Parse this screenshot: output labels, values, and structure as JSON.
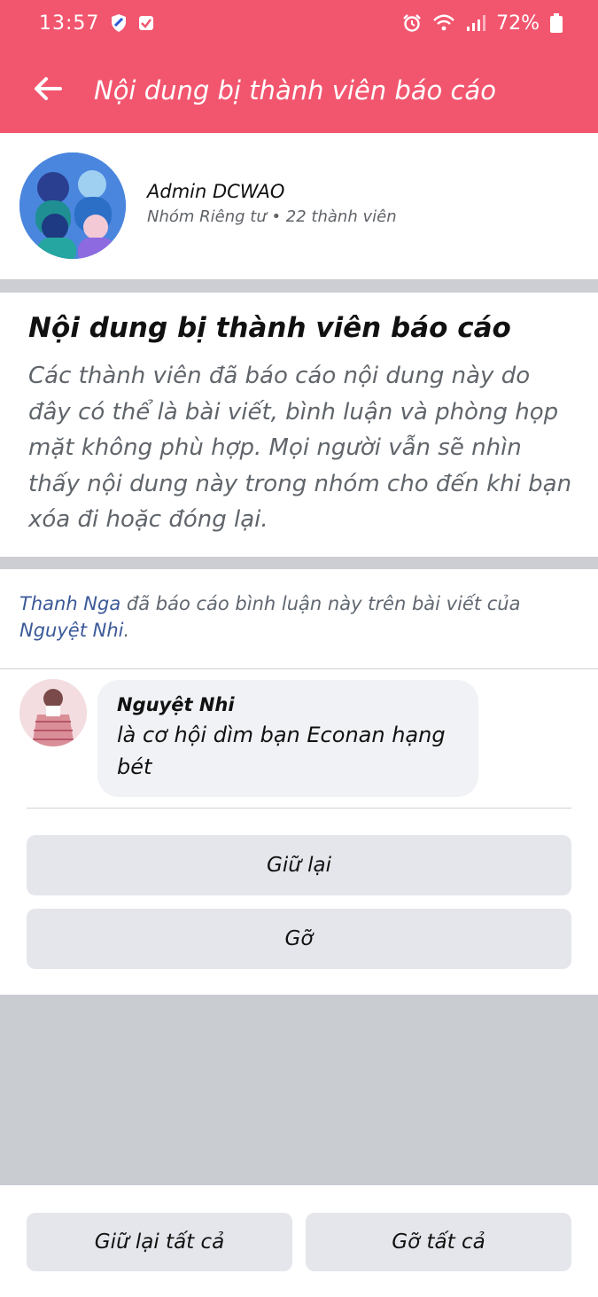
{
  "status_bar": {
    "time": "13:57",
    "battery": "72%",
    "icons": [
      "shield-icon",
      "check-icon",
      "alarm-icon",
      "wifi-icon",
      "signal-icon",
      "battery-icon"
    ]
  },
  "app_bar": {
    "title": "Nội dung bị thành viên báo cáo",
    "back_icon": "arrow-left-icon",
    "background": "#f2566f"
  },
  "group": {
    "name": "Admin DCWAO",
    "meta": "Nhóm Riêng tư • 22 thành viên"
  },
  "info": {
    "title": "Nội dung bị thành viên báo cáo",
    "description": "Các thành viên đã báo cáo nội dung này do đây có thể là bài viết, bình luận và phòng họp mặt không phù hợp. Mọi người vẫn sẽ nhìn thấy nội dung này trong nhóm cho đến khi bạn xóa đi hoặc đóng lại."
  },
  "report": {
    "reporter": "Thanh Nga",
    "middle_text": " đã báo cáo bình luận này trên bài viết của ",
    "post_author": "Nguyệt Nhi",
    "end": "."
  },
  "comment": {
    "author": "Nguyệt Nhi",
    "text": "là cơ hội dìm bạn Econan hạng bét"
  },
  "actions": {
    "keep": "Giữ lại",
    "remove": "Gỡ"
  },
  "bottom_actions": {
    "keep_all": "Giữ lại tất cả",
    "remove_all": "Gỡ tất cả"
  }
}
